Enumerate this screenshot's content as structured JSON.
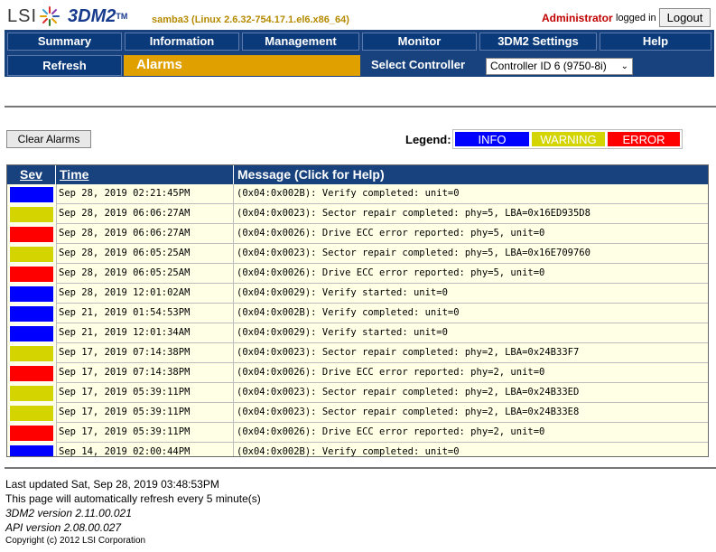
{
  "header": {
    "logo_text": "LSI",
    "product": "3DM2",
    "trademark": "TM",
    "host": "samba3 (Linux 2.6.32-754.17.1.el6.x86_64)",
    "user": "Administrator",
    "logged_in": "logged in",
    "logout_label": "Logout"
  },
  "nav": {
    "tabs": [
      "Summary",
      "Information",
      "Management",
      "Monitor",
      "3DM2 Settings",
      "Help"
    ],
    "refresh_label": "Refresh",
    "current_page": "Alarms",
    "select_label": "Select Controller",
    "controller_value": "Controller ID 6 (9750-8i)"
  },
  "toolbar": {
    "clear_label": "Clear Alarms"
  },
  "legend": {
    "label": "Legend:",
    "items": [
      {
        "label": "INFO",
        "color": "#0000ff"
      },
      {
        "label": "WARNING",
        "color": "#d4d400"
      },
      {
        "label": "ERROR",
        "color": "#ff0000"
      }
    ]
  },
  "table": {
    "headers": {
      "sev": "Sev",
      "time": "Time",
      "message": "Message (Click for Help)"
    },
    "rows": [
      {
        "sev": "info",
        "time": "Sep 28, 2019 02:21:45PM",
        "message": "(0x04:0x002B): Verify completed: unit=0"
      },
      {
        "sev": "warning",
        "time": "Sep 28, 2019 06:06:27AM",
        "message": "(0x04:0x0023): Sector repair completed: phy=5, LBA=0x16ED935D8"
      },
      {
        "sev": "error",
        "time": "Sep 28, 2019 06:06:27AM",
        "message": "(0x04:0x0026): Drive ECC error reported: phy=5, unit=0"
      },
      {
        "sev": "warning",
        "time": "Sep 28, 2019 06:05:25AM",
        "message": "(0x04:0x0023): Sector repair completed: phy=5, LBA=0x16E709760"
      },
      {
        "sev": "error",
        "time": "Sep 28, 2019 06:05:25AM",
        "message": "(0x04:0x0026): Drive ECC error reported: phy=5, unit=0"
      },
      {
        "sev": "info",
        "time": "Sep 28, 2019 12:01:02AM",
        "message": "(0x04:0x0029): Verify started: unit=0"
      },
      {
        "sev": "info",
        "time": "Sep 21, 2019 01:54:53PM",
        "message": "(0x04:0x002B): Verify completed: unit=0"
      },
      {
        "sev": "info",
        "time": "Sep 21, 2019 12:01:34AM",
        "message": "(0x04:0x0029): Verify started: unit=0"
      },
      {
        "sev": "warning",
        "time": "Sep 17, 2019 07:14:38PM",
        "message": "(0x04:0x0023): Sector repair completed: phy=2, LBA=0x24B33F7"
      },
      {
        "sev": "error",
        "time": "Sep 17, 2019 07:14:38PM",
        "message": "(0x04:0x0026): Drive ECC error reported: phy=2, unit=0"
      },
      {
        "sev": "warning",
        "time": "Sep 17, 2019 05:39:11PM",
        "message": "(0x04:0x0023): Sector repair completed: phy=2, LBA=0x24B33ED"
      },
      {
        "sev": "warning",
        "time": "Sep 17, 2019 05:39:11PM",
        "message": "(0x04:0x0023): Sector repair completed: phy=2, LBA=0x24B33E8"
      },
      {
        "sev": "error",
        "time": "Sep 17, 2019 05:39:11PM",
        "message": "(0x04:0x0026): Drive ECC error reported: phy=2, unit=0"
      },
      {
        "sev": "info",
        "time": "Sep 14, 2019 02:00:44PM",
        "message": "(0x04:0x002B): Verify completed: unit=0"
      }
    ]
  },
  "footer": {
    "last_updated": "Last updated Sat, Sep 28, 2019 03:48:53PM",
    "refresh_note": "This page will automatically refresh every 5 minute(s)",
    "version": "3DM2 version 2.11.00.021",
    "api_version": "API version 2.08.00.027",
    "copyright": "Copyright (c) 2012 LSI Corporation"
  },
  "colors": {
    "info": "#0000ff",
    "warning": "#d4d400",
    "error": "#ff0000",
    "nav": "#17427e",
    "active_tab": "#e0a000"
  }
}
